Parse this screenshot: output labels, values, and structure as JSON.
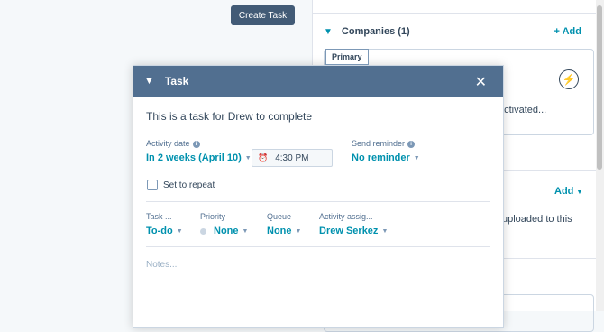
{
  "toolbar": {
    "create_task_label": "Create Task"
  },
  "sidebar": {
    "companies": {
      "title": "Companies (1)",
      "add_label": "+ Add"
    },
    "company_card": {
      "badge": "Primary",
      "activated_text": "activated..."
    },
    "section2": {
      "add_label": "Add",
      "text": "uploaded to this"
    }
  },
  "task_modal": {
    "title": "Task",
    "description": "This is a task for Drew to complete",
    "activity_date_label": "Activity date",
    "activity_date_value": "In 2 weeks (April 10)",
    "time_value": "4:30 PM",
    "send_reminder_label": "Send reminder",
    "send_reminder_value": "No reminder",
    "repeat_label": "Set to repeat",
    "fields": {
      "task_type_label": "Task ...",
      "task_type_value": "To-do",
      "priority_label": "Priority",
      "priority_value": "None",
      "queue_label": "Queue",
      "queue_value": "None",
      "assignee_label": "Activity assig...",
      "assignee_value": "Drew Serkez"
    },
    "notes_placeholder": "Notes..."
  },
  "colors": {
    "accent": "#0091ae",
    "header": "#516f90",
    "button": "#425b76"
  }
}
